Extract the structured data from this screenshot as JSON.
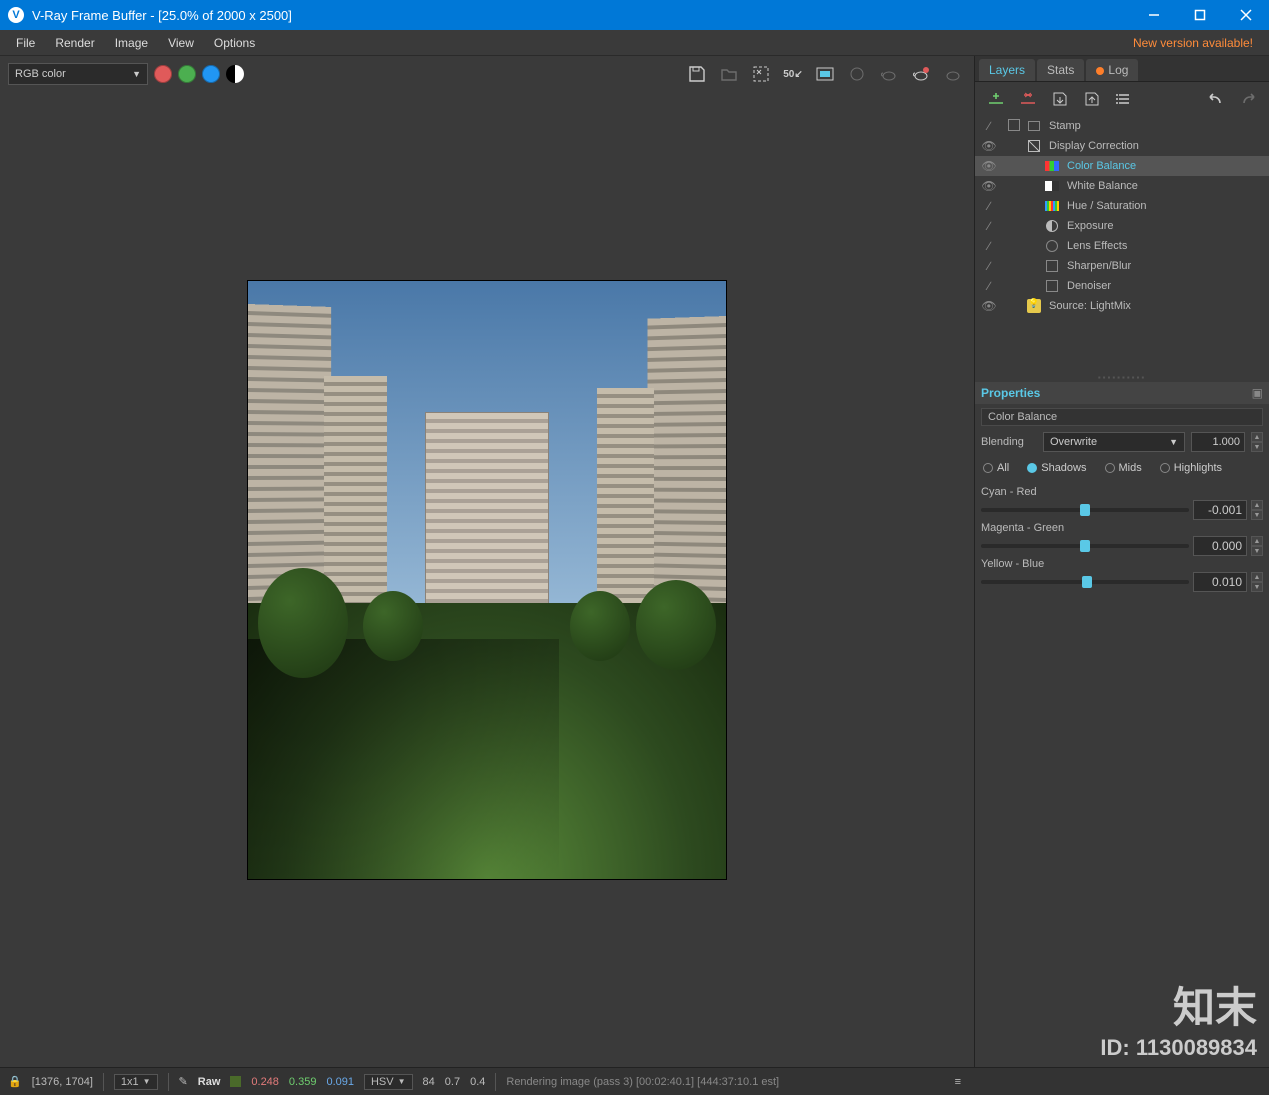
{
  "titlebar": {
    "title": "V-Ray Frame Buffer - [25.0% of 2000 x 2500]"
  },
  "menubar": {
    "items": [
      "File",
      "Render",
      "Image",
      "View",
      "Options"
    ],
    "new_version": "New version available!"
  },
  "toolbar": {
    "channel": "RGB color",
    "zoom_label": "50↙"
  },
  "right": {
    "tabs": {
      "layers": "Layers",
      "stats": "Stats",
      "log": "Log"
    },
    "layers": [
      {
        "eye": "∕",
        "icon": "stamp",
        "label": "Stamp",
        "checkbox": true,
        "indent": 0
      },
      {
        "eye": "👁",
        "icon": "curve",
        "label": "Display Correction",
        "indent": 0
      },
      {
        "eye": "👁",
        "icon": "rgb",
        "label": "Color Balance",
        "indent": 1,
        "selected": true
      },
      {
        "eye": "👁",
        "icon": "wb",
        "label": "White Balance",
        "indent": 1
      },
      {
        "eye": "∕",
        "icon": "hue",
        "label": "Hue / Saturation",
        "indent": 1
      },
      {
        "eye": "∕",
        "icon": "exp",
        "label": "Exposure",
        "indent": 1
      },
      {
        "eye": "∕",
        "icon": "lens",
        "label": "Lens Effects",
        "indent": 1
      },
      {
        "eye": "∕",
        "icon": "sharp",
        "label": "Sharpen/Blur",
        "indent": 1
      },
      {
        "eye": "∕",
        "icon": "den",
        "label": "Denoiser",
        "indent": 1
      },
      {
        "eye": "👁",
        "icon": "src",
        "label": "Source: LightMix",
        "indent": 0
      }
    ],
    "properties": {
      "header": "Properties",
      "name": "Color Balance",
      "blending_label": "Blending",
      "blending_value": "Overwrite",
      "blending_amount": "1.000",
      "radios": {
        "all": "All",
        "shadows": "Shadows",
        "mids": "Mids",
        "highlights": "Highlights",
        "selected": "shadows"
      },
      "sliders": [
        {
          "label": "Cyan - Red",
          "value": "-0.001",
          "pos": 49.8
        },
        {
          "label": "Magenta - Green",
          "value": "0.000",
          "pos": 50
        },
        {
          "label": "Yellow - Blue",
          "value": "0.010",
          "pos": 51
        }
      ]
    }
  },
  "statusbar": {
    "coords": "[1376, 1704]",
    "grid": "1x1",
    "raw": "Raw",
    "r": "0.248",
    "g": "0.359",
    "b": "0.091",
    "mode": "HSV",
    "h": "84",
    "s": "0.7",
    "v": "0.4",
    "rendering": "Rendering image (pass 3) [00:02:40.1] [444:37:10.1 est]"
  },
  "watermark": {
    "big": "知末",
    "id": "ID: 1130089834"
  }
}
